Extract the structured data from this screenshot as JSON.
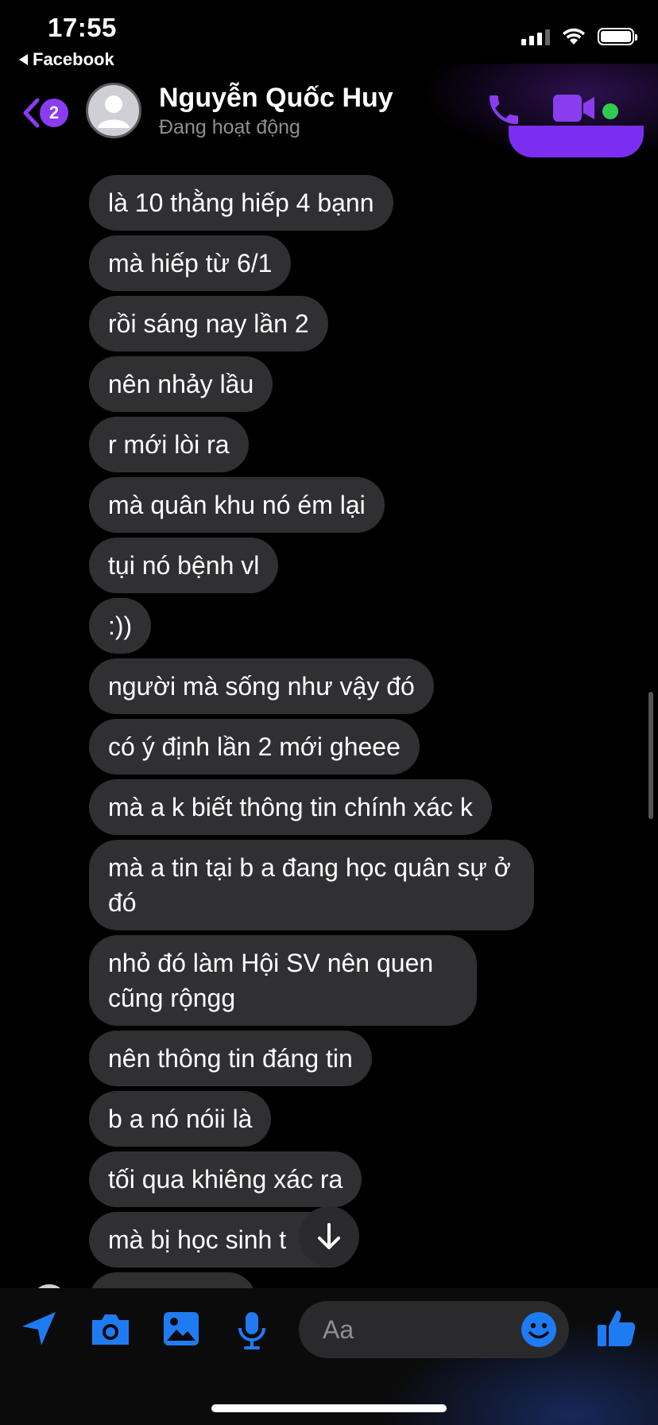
{
  "status_bar": {
    "time": "17:55",
    "back_app_label": "Facebook"
  },
  "header": {
    "unread_count": "2",
    "contact_name": "Nguyễn Quốc Huy",
    "presence": "Đang hoạt động",
    "online": true
  },
  "colors": {
    "accent": "#8a3cf0",
    "bubble": "#303033",
    "online": "#31c950",
    "tool_icon": "#1f7bf2"
  },
  "messages": [
    "là 10 thằng hiếp 4 bạnn",
    "mà hiếp từ 6/1",
    "rồi sáng nay lần 2",
    "nên nhảy lầu",
    "r mới lòi ra",
    "mà quân khu nó ém lại",
    "tụi nó bệnh vl",
    ":))",
    "người mà sống như vậy đó",
    "có ý định lần 2 mới gheee",
    "mà a k biết thông tin chính xác k",
    "mà a tin tại b a đang học quân sự ở đó",
    "nhỏ đó làm Hội SV nên quen cũng rộngg",
    "nên thông tin đáng tin",
    "b a nó nóii là",
    "tối qua khiêng xác ra",
    "mà bị học sinh t"
  ],
  "composer": {
    "placeholder": "Aa",
    "icons": [
      "location-icon",
      "camera-icon",
      "image-icon",
      "microphone-icon",
      "emoji-icon",
      "thumbs-up-icon"
    ]
  }
}
